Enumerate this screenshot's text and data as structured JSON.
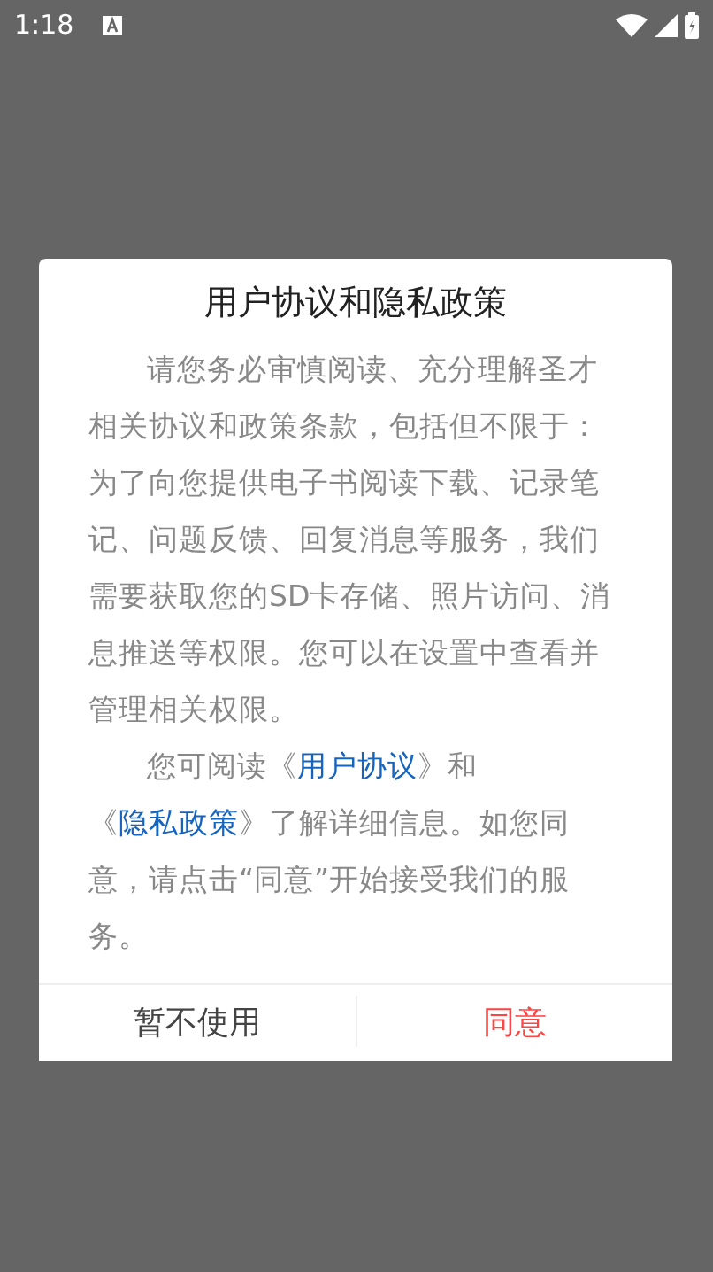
{
  "status_bar": {
    "time": "1:18"
  },
  "dialog": {
    "title": "用户协议和隐私政策",
    "paragraphs": [
      {
        "parts": [
          {
            "kind": "plain",
            "text": "请您务必审慎阅读、充分理解圣才相关协议和政策条款，包括但不限于：为了向您提供电子书阅读下载、记录笔记、问题反馈、回复消息等服务，我们需要获取您的SD卡存储、照片访问、消息推送等权限。您可以在设置中查看并管理相关权限。"
          }
        ]
      },
      {
        "parts": [
          {
            "kind": "plain",
            "text": "您可阅读《"
          },
          {
            "kind": "link",
            "text": "用户协议"
          },
          {
            "kind": "plain",
            "text": "》和《"
          },
          {
            "kind": "link",
            "text": "隐私政策"
          },
          {
            "kind": "plain",
            "text": "》了解详细信息。如您同意，请点击“同意”开始接受我们的服务。"
          }
        ]
      }
    ],
    "buttons": [
      {
        "label": "暂不使用",
        "kind": "secondary"
      },
      {
        "label": "同意",
        "kind": "primary"
      }
    ]
  }
}
